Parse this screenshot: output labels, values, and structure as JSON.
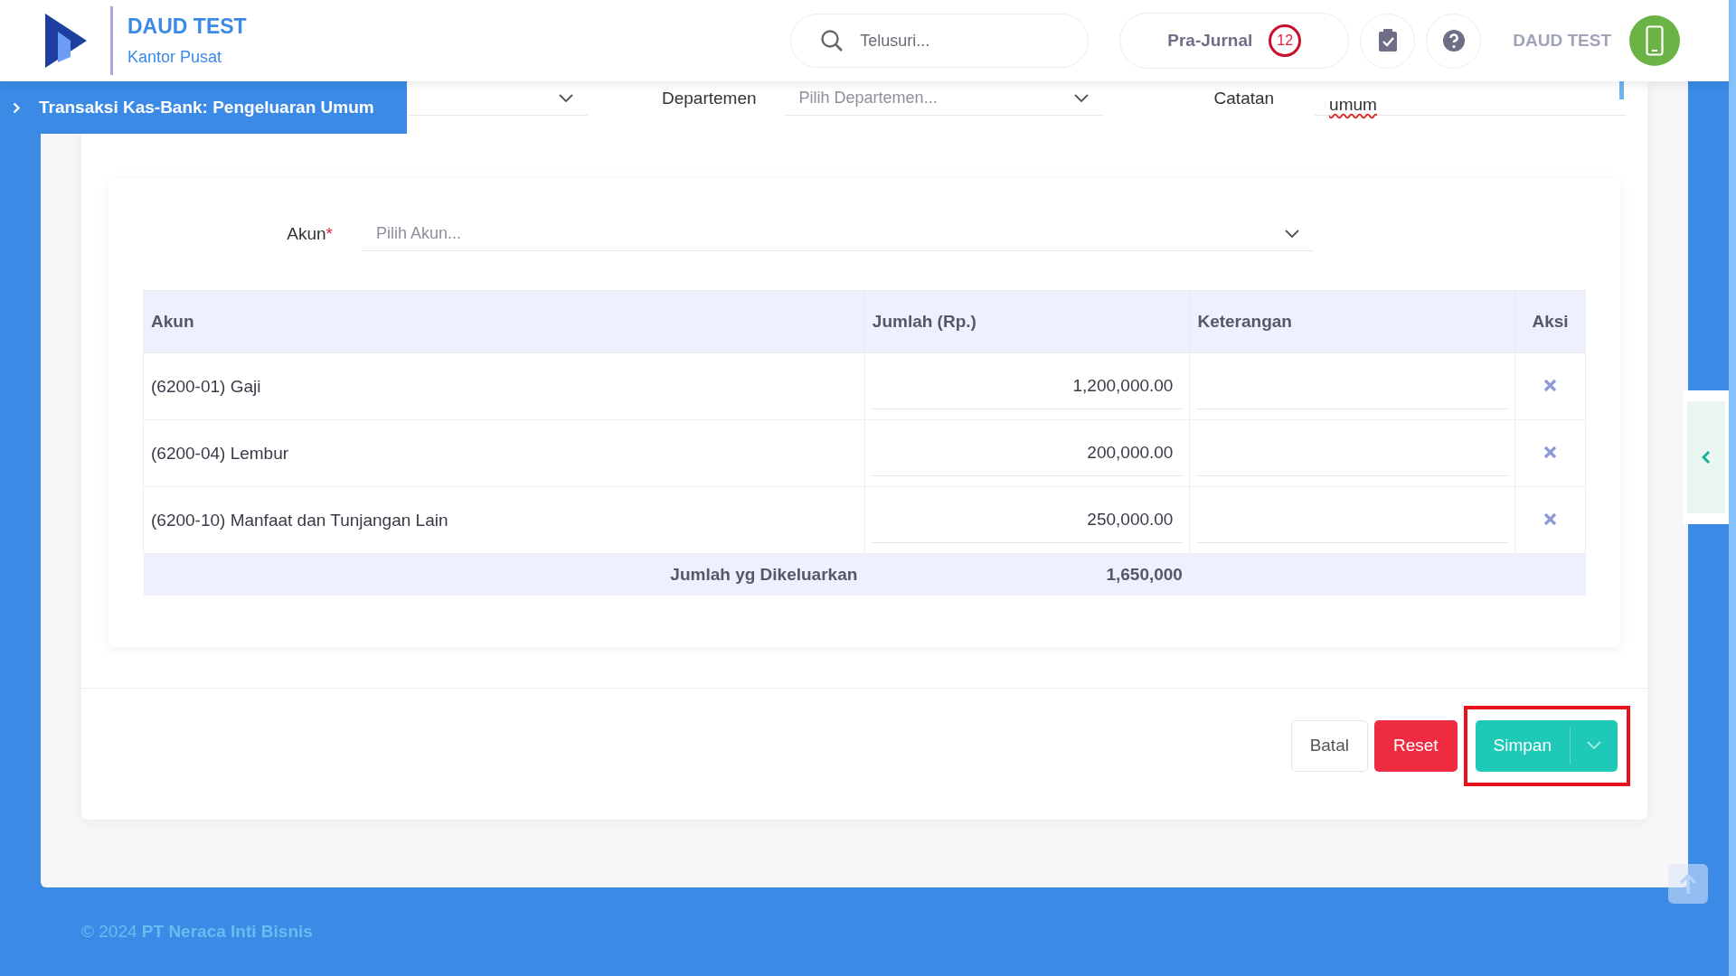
{
  "header": {
    "company": "DAUD TEST",
    "branch": "Kantor Pusat",
    "search": {
      "placeholder": "Telusuri..."
    },
    "pre_journal": {
      "label": "Pra-Jurnal",
      "count": "12"
    },
    "user": "DAUD TEST"
  },
  "breadcrumb": {
    "title": "Transaksi Kas-Bank: Pengeluaran Umum"
  },
  "form": {
    "department": {
      "label": "Departemen",
      "placeholder": "Pilih Departemen..."
    },
    "note": {
      "label": "Catatan",
      "value": "umum"
    }
  },
  "account_picker": {
    "label": "Akun",
    "required_mark": "*",
    "placeholder": "Pilih Akun..."
  },
  "table": {
    "columns": [
      "Akun",
      "Jumlah (Rp.)",
      "Keterangan",
      "Aksi"
    ],
    "rows": [
      {
        "account": "(6200-01) Gaji",
        "amount": "1,200,000.00"
      },
      {
        "account": "(6200-04) Lembur",
        "amount": "200,000.00"
      },
      {
        "account": "(6200-10) Manfaat dan Tunjangan Lain",
        "amount": "250,000.00"
      }
    ],
    "total": {
      "label": "Jumlah yg Dikeluarkan",
      "value": "1,650,000"
    }
  },
  "buttons": [
    {
      "kind": "outline",
      "label": "Batal"
    },
    {
      "kind": "danger",
      "label": "Reset"
    },
    {
      "kind": "split",
      "label": "Simpan",
      "highlighted": true
    }
  ],
  "footer": {
    "text": "© 2024 **PT Neraca Inti Bisnis**"
  }
}
